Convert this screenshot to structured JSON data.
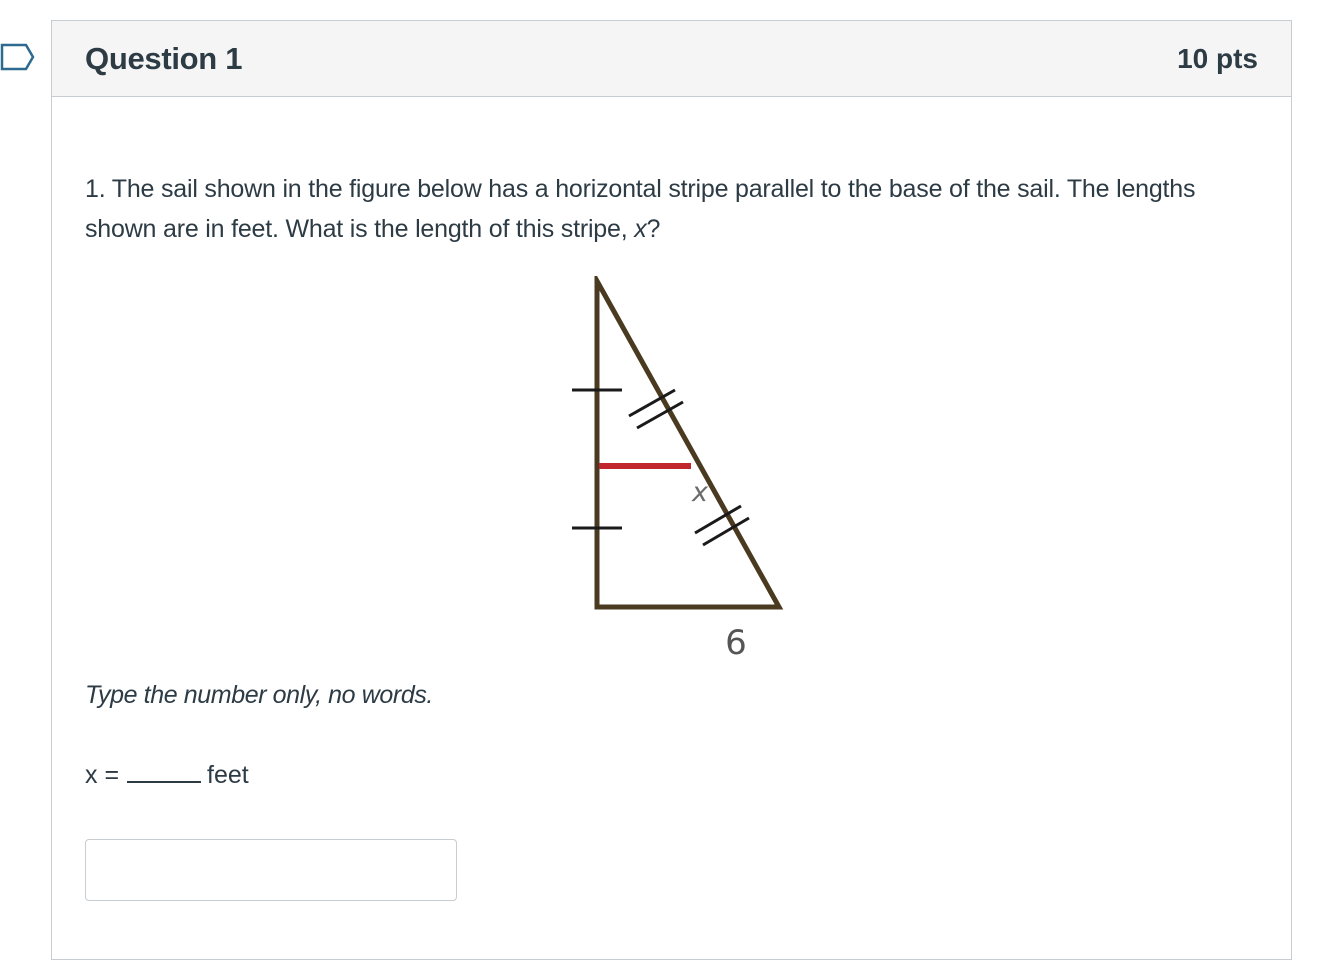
{
  "question": {
    "title": "Question 1",
    "points": "10 pts",
    "text_part1": "1. The sail shown in the figure below has a horizontal stripe parallel to the base of the sail. The lengths shown are in feet. What is the length of this stripe, ",
    "text_var": "x",
    "text_part2": "?",
    "instruction": "Type the number only, no words.",
    "answer_prefix": "x =",
    "answer_unit": "feet"
  },
  "figure": {
    "stripe_label": "x",
    "base_label": "6",
    "colors": {
      "outline": "#4a3a20",
      "stripe": "#c0262c"
    }
  },
  "answer_input": {
    "value": "",
    "placeholder": ""
  },
  "colors": {
    "text": "#2d3b45",
    "header_bg": "#f5f5f5",
    "border": "#c7cdd1",
    "flag": "#2d6a8f"
  }
}
